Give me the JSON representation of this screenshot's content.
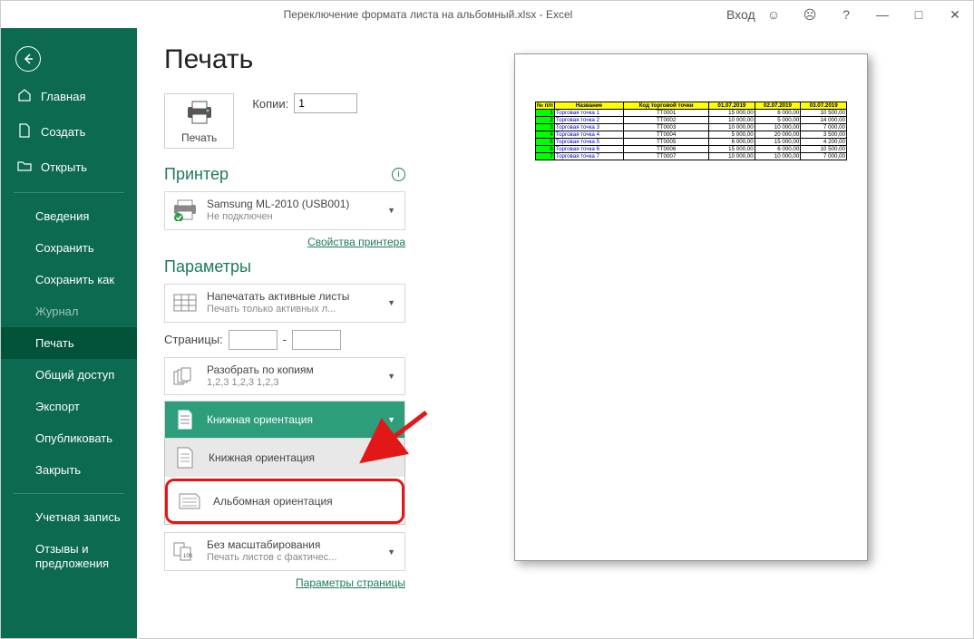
{
  "titlebar": {
    "title": "Переключение формата листа на альбомный.xlsx  -  Excel",
    "login": "Вход"
  },
  "sidebar": {
    "back": "←",
    "home": "Главная",
    "create": "Создать",
    "open": "Открыть",
    "info": "Сведения",
    "save": "Сохранить",
    "saveas": "Сохранить как",
    "history": "Журнал",
    "print": "Печать",
    "share": "Общий доступ",
    "export": "Экспорт",
    "publish": "Опубликовать",
    "close": "Закрыть",
    "account": "Учетная запись",
    "feedback": "Отзывы и предложения"
  },
  "panel": {
    "heading": "Печать",
    "print_label": "Печать",
    "copies_label": "Копии:",
    "copies_value": "1",
    "printer_heading": "Принтер",
    "printer_name": "Samsung ML-2010 (USB001)",
    "printer_status": "Не подключен",
    "printer_props": "Свойства принтера",
    "params_heading": "Параметры",
    "active_sheets": "Напечатать активные листы",
    "active_sheets_sub": "Печать только активных л...",
    "pages_label": "Страницы:",
    "pages_sep": "-",
    "collate": "Разобрать по копиям",
    "collate_sub": "1,2,3    1,2,3    1,2,3",
    "portrait": "Книжная ориентация",
    "drop_portrait": "Книжная ориентация",
    "drop_landscape": "Альбомная ориентация",
    "scale": "Без масштабирования",
    "scale_sub": "Печать листов с фактичес...",
    "scale_badge": "100",
    "page_setup": "Параметры страницы"
  },
  "preview": {
    "headers": [
      "№ п/п",
      "Название",
      "Код торговой точки",
      "01.07.2019",
      "02.07.2019",
      "03.07.2019"
    ],
    "rows": [
      [
        "1",
        "Торговая точка 1",
        "TT0001",
        "15 000,00",
        "6 000,00",
        "10 500,00"
      ],
      [
        "2",
        "Торговая точка 2",
        "TT0002",
        "10 000,00",
        "5 000,00",
        "14 000,00"
      ],
      [
        "3",
        "Торговая точка 3",
        "TT0003",
        "10 000,00",
        "10 000,00",
        "7 000,00"
      ],
      [
        "4",
        "Торговая точка 4",
        "TT0004",
        "5 000,00",
        "20 000,00",
        "3 500,00"
      ],
      [
        "5",
        "Торговая точка 5",
        "TT0005",
        "6 000,00",
        "15 000,00",
        "4 200,00"
      ],
      [
        "6",
        "Торговая точка 6",
        "TT0006",
        "15 000,00",
        "6 000,00",
        "10 500,00"
      ],
      [
        "7",
        "Торговая точка 7",
        "TT0007",
        "10 000,00",
        "10 000,00",
        "7 000,00"
      ]
    ]
  }
}
